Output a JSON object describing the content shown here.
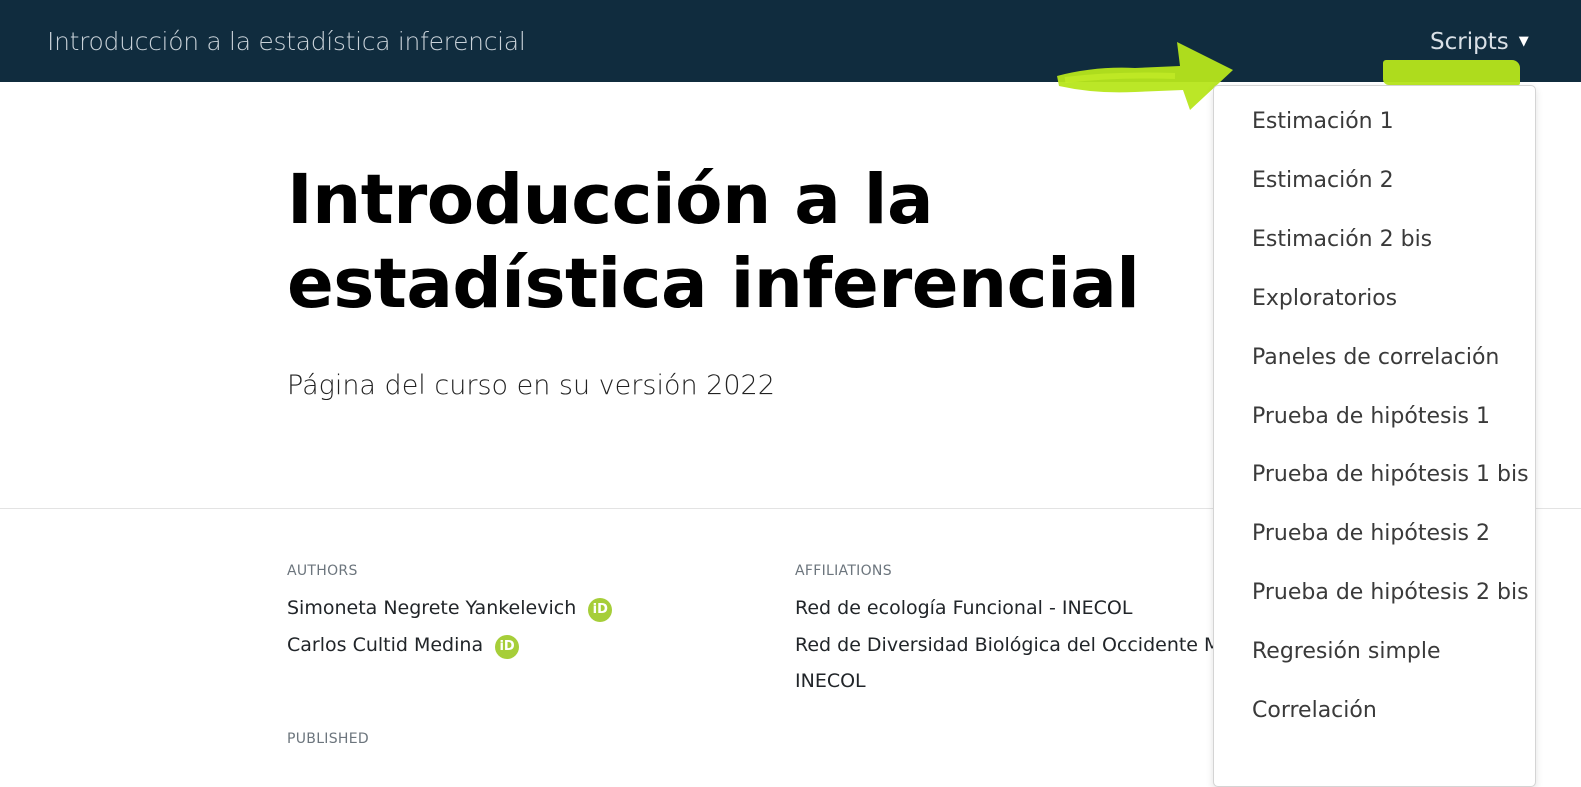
{
  "navbar": {
    "title": "Introducción a la estadística inferencial",
    "menu_label": "Scripts",
    "caret": "▼"
  },
  "header": {
    "title": "Introducción a la estadística inferencial",
    "subtitle": "Página del curso en su versión 2022"
  },
  "meta": {
    "authors_label": "AUTHORS",
    "authors": [
      "Simoneta Negrete Yankelevich",
      "Carlos Cultid Medina"
    ],
    "orcid_glyph": "iD",
    "affiliations_label": "AFFILIATIONS",
    "affiliations": [
      "Red de ecología Funcional - INECOL",
      "Red de Diversidad Biológica del Occidente Mex",
      "INECOL"
    ],
    "published_label": "PUBLISHED"
  },
  "dropdown": {
    "items": [
      "Estimación 1",
      "Estimación 2",
      "Estimación 2 bis",
      "Exploratorios",
      "Paneles de correlación",
      "Prueba de hipótesis 1",
      "Prueba de hipótesis 1 bis",
      "Prueba de hipótesis 2",
      "Prueba de hipótesis 2 bis",
      "Regresión simple",
      "Correlación"
    ]
  },
  "colors": {
    "navbar_bg": "#102c3e",
    "highlight": "#b7e61b",
    "orcid": "#a6ce39"
  }
}
